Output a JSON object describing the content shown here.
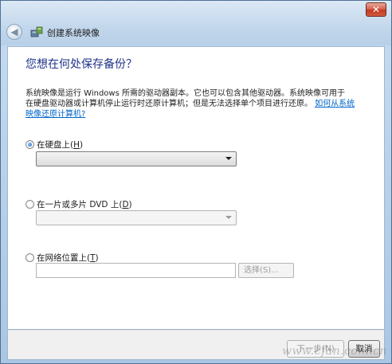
{
  "window": {
    "close_label": "✕",
    "back_label": "◀",
    "title": "创建系统映像"
  },
  "page": {
    "heading": "您想在何处保存备份？",
    "description_line1": "系统映像是运行 Windows 所需的驱动器副本。它也可以包含其他驱动器。系统映像可用于",
    "description_line2": "在硬盘驱动器或计算机停止运行时还原计算机；但是无法选择单个项目进行还原。",
    "help_link": "如何从系统映像还原计算机?"
  },
  "options": {
    "hard_disk": {
      "label": "在硬盘上(",
      "key": "H",
      "close": ")",
      "checked": true
    },
    "dvd": {
      "label": "在一片或多片 DVD 上(",
      "key": "D",
      "close": ")",
      "checked": false
    },
    "network": {
      "label": "在网络位置上(",
      "key": "T",
      "close": ")",
      "checked": false
    }
  },
  "network": {
    "path_value": "",
    "browse_label": "选择(S)..."
  },
  "footer": {
    "next_label": "下一步(N)",
    "cancel_label": "取消"
  },
  "watermark": "www.cfan.com.cn",
  "colors": {
    "heading": "#1e3287",
    "link": "#0066cc",
    "frame": "#a9c6e2",
    "close": "#c23a22"
  }
}
